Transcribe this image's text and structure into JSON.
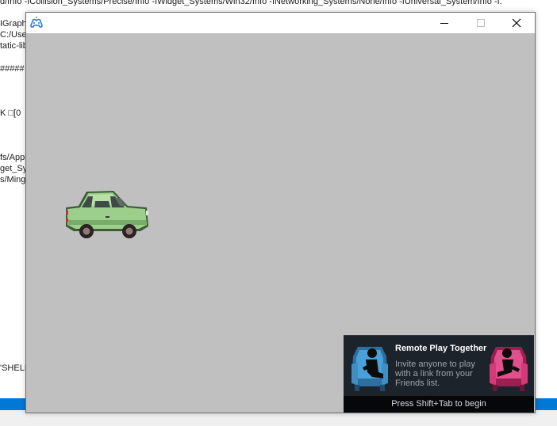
{
  "background_console": {
    "lines": [
      "d/Info -ICollision_Systems/Precise/Info -IWidget_Systems/Win32/Info -INetworking_Systems/None/Info -IUniversal_System/Info -I.",
      "",
      "IGraph",
      "C:/Use",
      "tatic-lib",
      "",
      "#####",
      "",
      "",
      "",
      "K □[0",
      "",
      "",
      "",
      "fs/Appl",
      "get_Sy",
      "s/Ming",
      "",
      "",
      "",
      "",
      "",
      "",
      "",
      "",
      "",
      "",
      "",
      "",
      "",
      "",
      "",
      "",
      "'SHELL'"
    ]
  },
  "window": {
    "icon": "gamepad-app-icon",
    "title": "",
    "minimize_icon": "minimize-icon",
    "maximize_icon": "maximize-icon",
    "close_icon": "close-icon",
    "canvas_color": "#c0c0c0",
    "sprite": "car-sprite"
  },
  "remote_play": {
    "title": "Remote Play Together",
    "body": "Invite anyone to play with a link from your Friends list.",
    "footer": "Press Shift+Tab to begin",
    "left_icon": "blue-armchair-player-icon",
    "right_icon": "pink-armchair-player-icon",
    "colors": {
      "background": "#1c232b",
      "footer_bg": "#050709",
      "blue": "#3f8fc4",
      "pink": "#d23a78"
    }
  }
}
